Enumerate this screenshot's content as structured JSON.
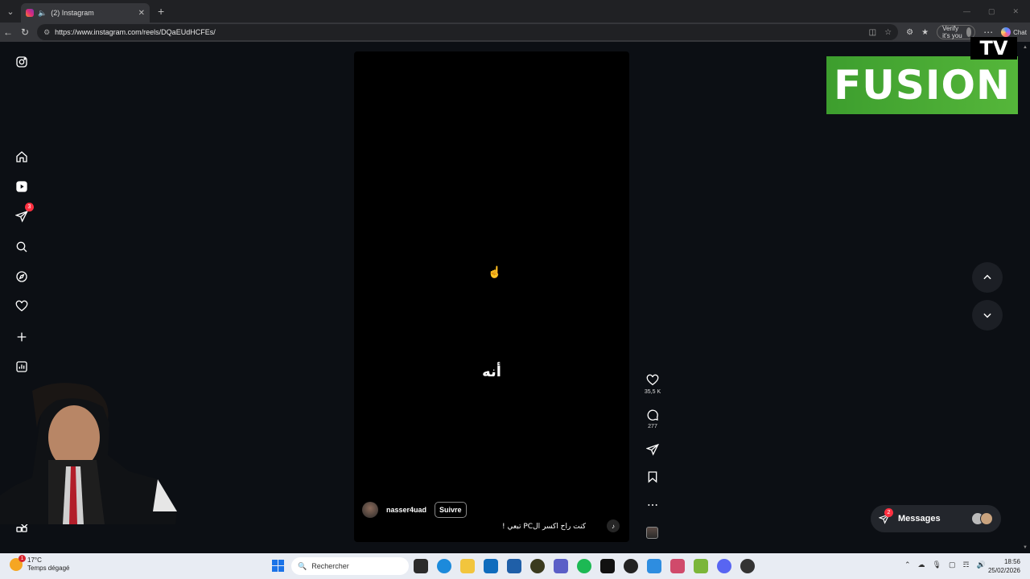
{
  "browser": {
    "tab_title": "(2) Instagram",
    "url": "https://www.instagram.com/reels/DQaEUdHCFEs/",
    "verify_label": "Verify it's you",
    "chat_label": "Chat"
  },
  "sidebar": {
    "items": [
      {
        "name": "instagram-logo-icon"
      },
      {
        "name": "home-icon"
      },
      {
        "name": "reels-icon"
      },
      {
        "name": "direct-messages-icon",
        "badge": "3"
      },
      {
        "name": "search-icon"
      },
      {
        "name": "explore-icon"
      },
      {
        "name": "notifications-heart-icon"
      },
      {
        "name": "create-plus-icon"
      },
      {
        "name": "dashboard-icon"
      },
      {
        "name": "more-grid-icon"
      }
    ]
  },
  "reel": {
    "overlay_text": "أنه",
    "username": "nasser4uad",
    "follow_label": "Suivre",
    "description": "كنت راح اكسر الPC تبعي !",
    "likes": "35,5 K",
    "comments": "277"
  },
  "messages": {
    "label": "Messages",
    "badge": "2"
  },
  "overlay_logo": {
    "main": "FUSION",
    "tv": "TV"
  },
  "taskbar": {
    "temperature": "17°C",
    "weather": "Temps dégagé",
    "weather_badge": "1",
    "search_placeholder": "Rechercher",
    "time": "18:56",
    "date": "25/02/2026"
  },
  "colors": {
    "page_bg": "#0c0f14",
    "badge_red": "#ff3040",
    "logo_green": "#4aab34"
  }
}
